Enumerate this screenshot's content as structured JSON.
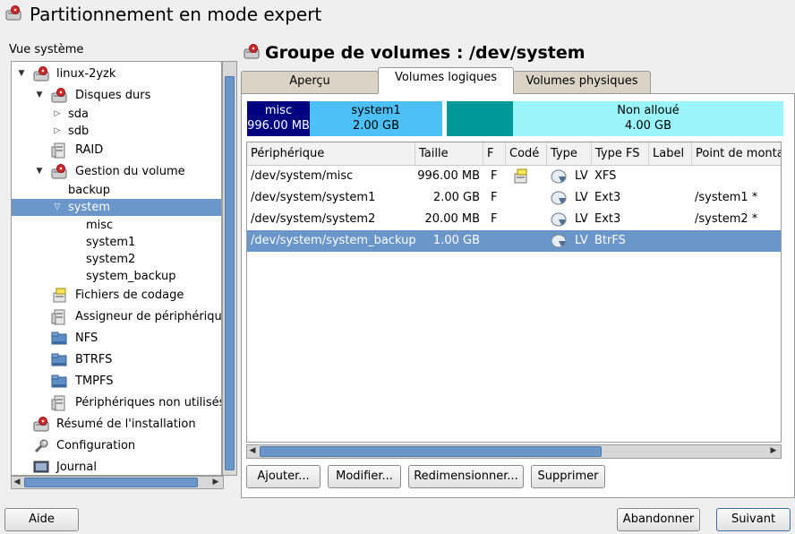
{
  "window": {
    "title": "Partitionnement en mode expert"
  },
  "sidebar": {
    "label": "Vue système",
    "tree": [
      {
        "label": "linux-2yzk"
      },
      {
        "label": "Disques durs"
      },
      {
        "label": "sda"
      },
      {
        "label": "sdb"
      },
      {
        "label": "RAID"
      },
      {
        "label": "Gestion du volume"
      },
      {
        "label": "backup"
      },
      {
        "label": "system"
      },
      {
        "label": "misc"
      },
      {
        "label": "system1"
      },
      {
        "label": "system2"
      },
      {
        "label": "system_backup"
      },
      {
        "label": "Fichiers de codage"
      },
      {
        "label": "Assigneur de périphérique"
      },
      {
        "label": "NFS"
      },
      {
        "label": "BTRFS"
      },
      {
        "label": "TMPFS"
      },
      {
        "label": "Périphériques non utilisés"
      },
      {
        "label": "Résumé de l'installation"
      },
      {
        "label": "Configuration"
      },
      {
        "label": "Journal"
      }
    ]
  },
  "main": {
    "title": "Groupe de volumes : /dev/system",
    "tabs": [
      {
        "label": "Aperçu"
      },
      {
        "label": "Volumes logiques"
      },
      {
        "label": "Volumes physiques"
      }
    ],
    "active_tab": "Volumes logiques",
    "usage_bar": [
      {
        "name": "misc",
        "size": "996.00 MB",
        "color": "#000080"
      },
      {
        "name": "system1",
        "size": "2.00 GB",
        "color": "#4dc0f7"
      },
      {
        "name": "",
        "size": "",
        "color": "#00999a"
      },
      {
        "name": "Non alloué",
        "size": "4.00 GB",
        "color": "#99f5fa"
      }
    ],
    "table": {
      "columns": [
        "Périphérique",
        "Taille",
        "F",
        "Codé",
        "Type",
        "Type FS",
        "Label",
        "Point de montage"
      ],
      "rows": [
        {
          "device": "/dev/system/misc",
          "size": "996.00 MB",
          "f": "F",
          "encrypted": true,
          "type": "LV",
          "fs": "XFS",
          "label": "",
          "mount": ""
        },
        {
          "device": "/dev/system/system1",
          "size": "2.00 GB",
          "f": "F",
          "encrypted": false,
          "type": "LV",
          "fs": "Ext3",
          "label": "",
          "mount": "/system1 *"
        },
        {
          "device": "/dev/system/system2",
          "size": "20.00 MB",
          "f": "F",
          "encrypted": false,
          "type": "LV",
          "fs": "Ext3",
          "label": "",
          "mount": "/system2 *"
        },
        {
          "device": "/dev/system/system_backup",
          "size": "1.00 GB",
          "f": "",
          "encrypted": false,
          "type": "LV",
          "fs": "BtrFS",
          "label": "",
          "mount": ""
        }
      ],
      "selected_row": 3
    },
    "buttons": {
      "add": "Ajouter...",
      "edit": "Modifier...",
      "resize": "Redimensionner...",
      "delete": "Supprimer"
    }
  },
  "footer": {
    "help": "Aide",
    "abort": "Abandonner",
    "next": "Suivant"
  }
}
